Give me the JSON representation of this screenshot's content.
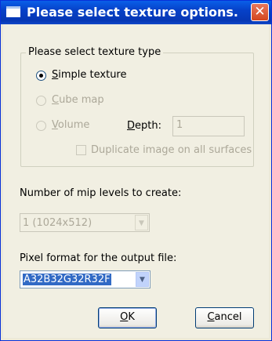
{
  "dialog": {
    "title": "Please select texture options.",
    "close_symbol": "✕"
  },
  "texture_type": {
    "group_label": "Please select texture type",
    "options": [
      {
        "first_letter": "S",
        "rest": "imple texture",
        "selected": true,
        "enabled": true
      },
      {
        "first_letter": "C",
        "rest": "ube map",
        "selected": false,
        "enabled": false
      },
      {
        "first_letter": "V",
        "rest": "olume",
        "selected": false,
        "enabled": false
      }
    ],
    "depth_label_first": "D",
    "depth_label_rest": "epth:",
    "depth_value": "1",
    "duplicate_label": "Duplicate image on all surfaces",
    "duplicate_checked": false
  },
  "mip_levels": {
    "label": "Number of mip levels to create:",
    "value": "1 (1024x512)"
  },
  "pixel_format": {
    "label": "Pixel format for the output file:",
    "value": "A32B32G32R32F"
  },
  "buttons": {
    "ok_first": "O",
    "ok_rest": "K",
    "cancel_first": "C",
    "cancel_rest": "ancel"
  },
  "icons": {
    "title": "window-icon",
    "close": "close-icon",
    "dropdown": "chevron-down-icon"
  }
}
